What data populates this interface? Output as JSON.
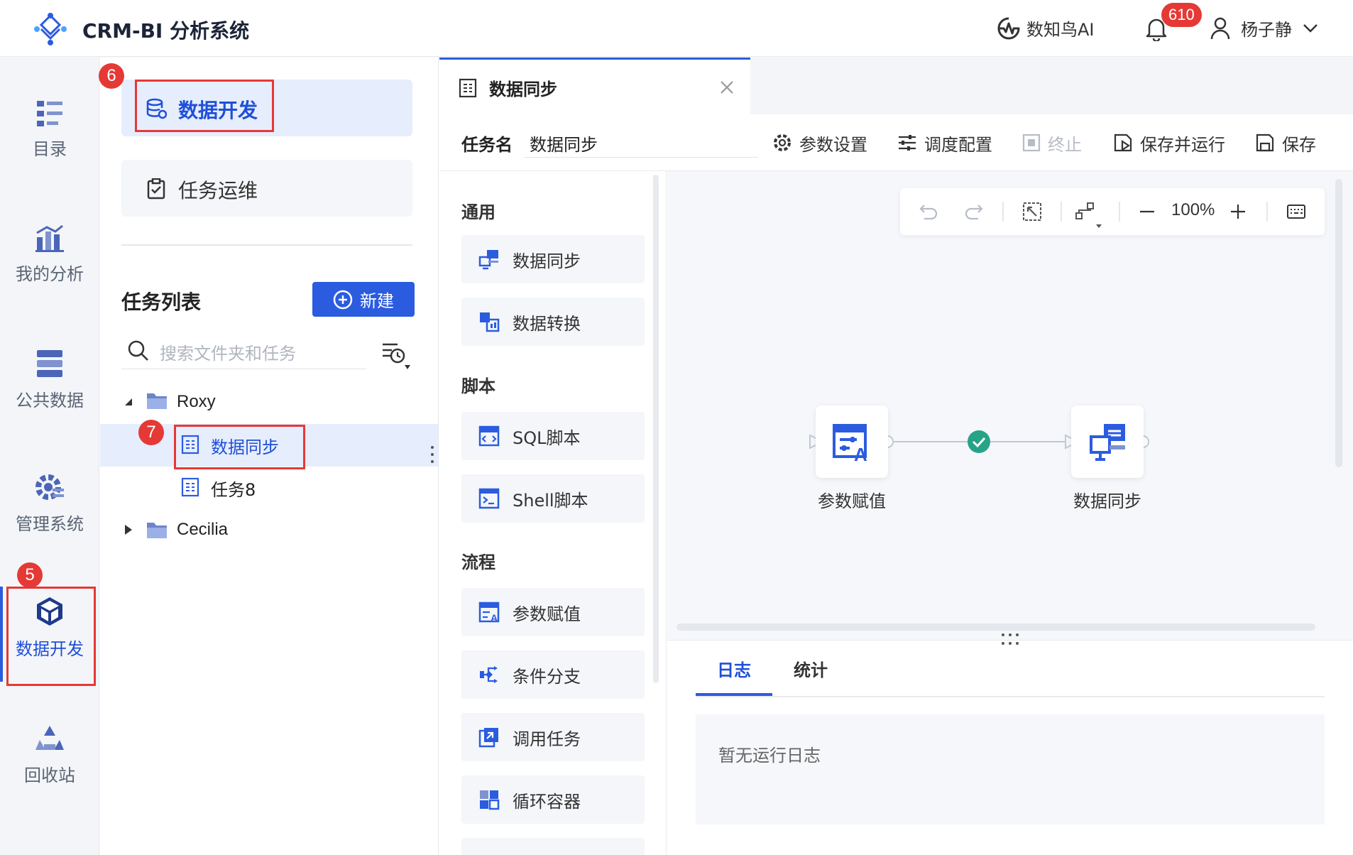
{
  "header": {
    "app_title": "CRM-BI 分析系统",
    "ai_label": "数知鸟AI",
    "notification_count": "610",
    "user_name": "杨子静"
  },
  "leftnav": {
    "items": [
      {
        "label": "目录",
        "icon": "list-icon"
      },
      {
        "label": "我的分析",
        "icon": "chart-icon"
      },
      {
        "label": "公共数据",
        "icon": "database-icon"
      },
      {
        "label": "管理系统",
        "icon": "gear-icon"
      },
      {
        "label": "数据开发",
        "icon": "cube-icon",
        "active": true
      },
      {
        "label": "回收站",
        "icon": "recycle-icon"
      }
    ]
  },
  "sidebar": {
    "data_dev_label": "数据开发",
    "task_ops_label": "任务运维",
    "task_list_title": "任务列表",
    "new_button": "新建",
    "search_placeholder": "搜索文件夹和任务",
    "tree": [
      {
        "label": "Roxy",
        "type": "folder",
        "expanded": true
      },
      {
        "label": "数据同步",
        "type": "task",
        "selected": true
      },
      {
        "label": "任务8",
        "type": "task"
      },
      {
        "label": "Cecilia",
        "type": "folder",
        "expanded": false
      }
    ]
  },
  "annotations": {
    "n5": "5",
    "n6": "6",
    "n7": "7"
  },
  "tab": {
    "label": "数据同步"
  },
  "toolbar": {
    "task_name_label": "任务名",
    "task_name_value": "数据同步",
    "param_settings": "参数设置",
    "schedule_config": "调度配置",
    "stop": "终止",
    "save_run": "保存并运行",
    "save": "保存"
  },
  "components": {
    "cat_general": "通用",
    "cat_script": "脚本",
    "cat_flow": "流程",
    "items": [
      "数据同步",
      "数据转换",
      "SQL脚本",
      "Shell脚本",
      "参数赋值",
      "条件分支",
      "调用任务",
      "循环容器"
    ]
  },
  "canvas": {
    "zoom": "100%",
    "nodes": [
      {
        "label": "参数赋值"
      },
      {
        "label": "数据同步"
      }
    ]
  },
  "log": {
    "tab_log": "日志",
    "tab_stats": "统计",
    "empty_text": "暂无运行日志"
  },
  "colors": {
    "accent": "#2b5ce0",
    "annotation": "#e53935",
    "success": "#27a387"
  }
}
